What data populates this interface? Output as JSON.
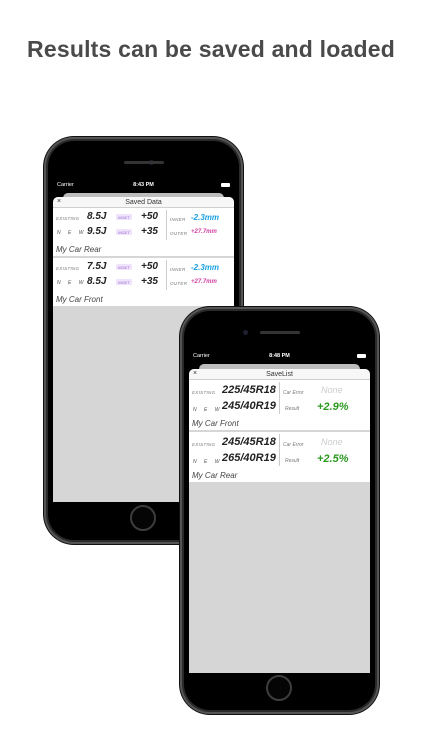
{
  "headline": "Results can be saved and loaded",
  "phone1": {
    "status": {
      "carrier": "Carrier",
      "time": "8:43 PM"
    },
    "nav": {
      "close": "×",
      "title": "Saved Data"
    },
    "records": [
      {
        "existing_label": "EXISTING",
        "new_label": "N E W",
        "existing_rim": "8.5J",
        "new_rim": "9.5J",
        "inset_label": "INSET",
        "existing_offset": "+50",
        "new_offset": "+35",
        "inner_label": "INNER",
        "outer_label": "OUTER",
        "inner_value": "-2.3mm",
        "outer_value": "+27.7mm",
        "name": "My Car Rear"
      },
      {
        "existing_label": "EXISTING",
        "new_label": "N E W",
        "existing_rim": "7.5J",
        "new_rim": "8.5J",
        "inset_label": "INSET",
        "existing_offset": "+50",
        "new_offset": "+35",
        "inner_label": "INNER",
        "outer_label": "OUTER",
        "inner_value": "-2.3mm",
        "outer_value": "+27.7mm",
        "name": "My Car Front"
      }
    ]
  },
  "phone2": {
    "status": {
      "carrier": "Carrier",
      "time": "8:48 PM"
    },
    "nav": {
      "close": "×",
      "title": "SaveList"
    },
    "records": [
      {
        "existing_label": "EXISTING",
        "new_label": "N E W",
        "existing_tire": "225/45R18",
        "new_tire": "245/40R19",
        "car_error_label": "Car Error",
        "car_error_value": "None",
        "result_label": "Result",
        "result_value": "+2.9%",
        "name": "My Car Front"
      },
      {
        "existing_label": "EXISTING",
        "new_label": "N E W",
        "existing_tire": "245/45R18",
        "new_tire": "265/40R19",
        "car_error_label": "Car Error",
        "car_error_value": "None",
        "result_label": "Result",
        "result_value": "+2.5%",
        "name": "My Car Rear"
      }
    ]
  },
  "colors": {
    "inner": "#1aa0e0",
    "outer": "#d040a0",
    "result": "#2a9a1e",
    "inset": "#9a6bd0"
  }
}
